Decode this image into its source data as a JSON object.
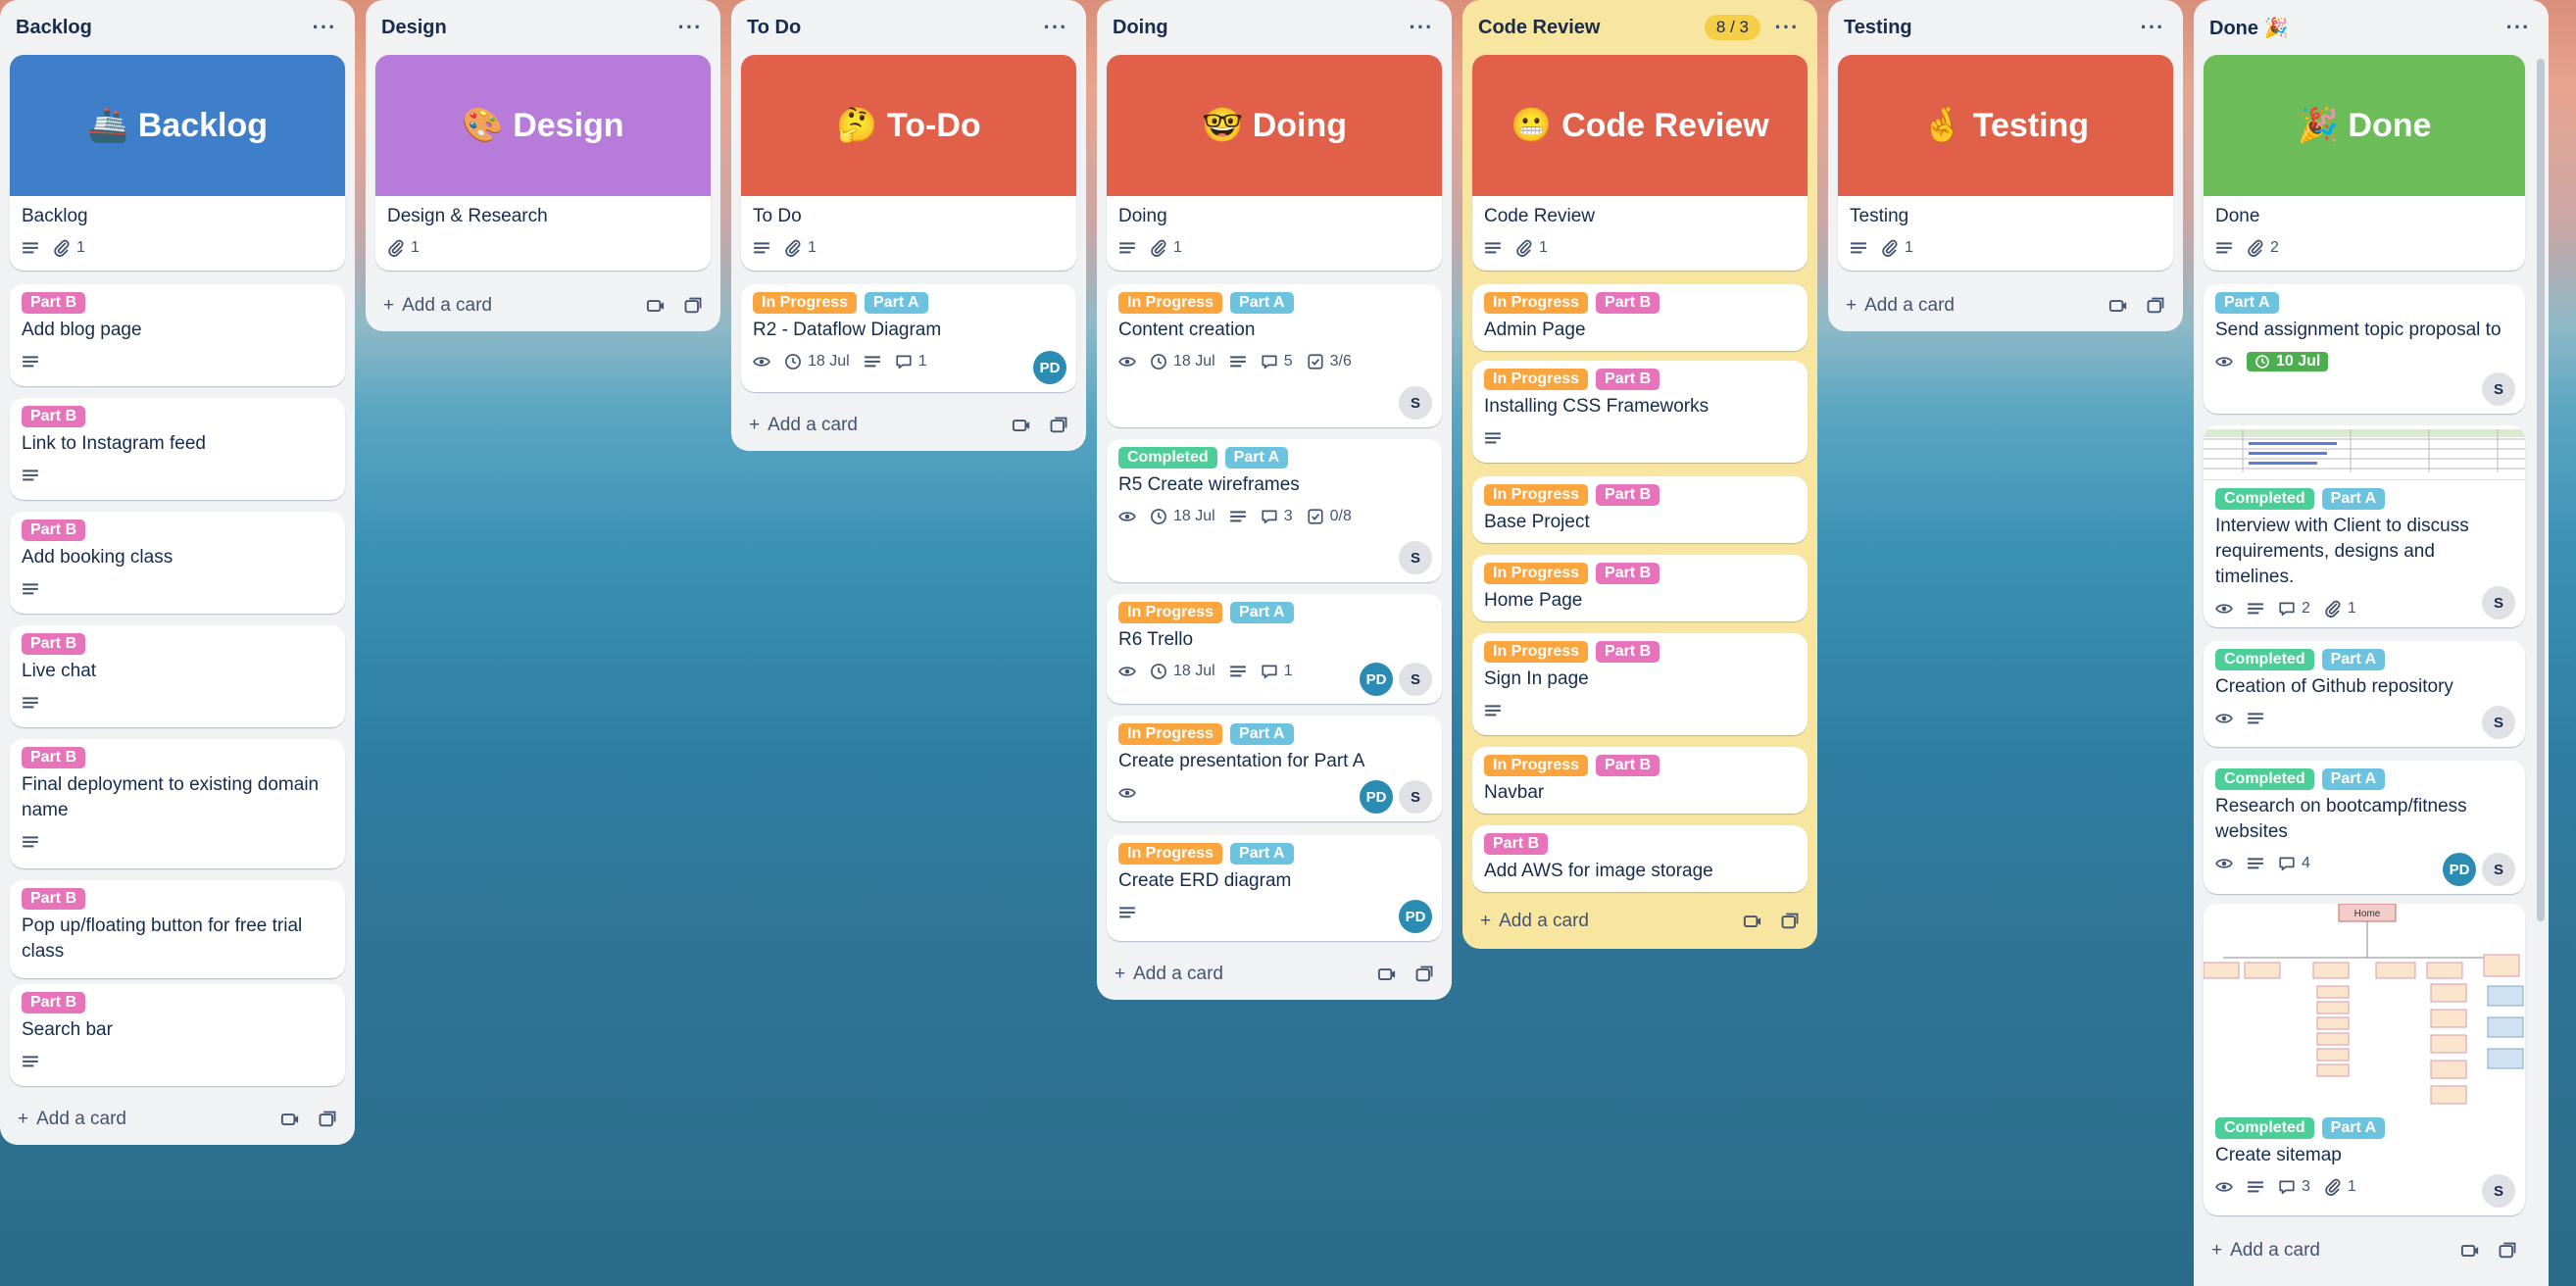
{
  "lists": [
    {
      "title": "Backlog",
      "cover_title": "🚢 Backlog",
      "cover_color": "#3f7fc9",
      "first_card_title": "Backlog",
      "first_card_attach": "1",
      "cards": [
        {
          "labels": [
            "Part B"
          ],
          "title": "Add blog page"
        },
        {
          "labels": [
            "Part B"
          ],
          "title": "Link to Instagram feed"
        },
        {
          "labels": [
            "Part B"
          ],
          "title": "Add booking class"
        },
        {
          "labels": [
            "Part B"
          ],
          "title": "Live chat"
        },
        {
          "labels": [
            "Part B"
          ],
          "title": "Final deployment to existing domain name"
        },
        {
          "labels": [
            "Part B"
          ],
          "title": "Pop up/floating button for free trial class"
        },
        {
          "labels": [
            "Part B"
          ],
          "title": "Search bar"
        }
      ],
      "add_label": "Add a card"
    },
    {
      "title": "Design",
      "cover_title": "🎨 Design",
      "cover_color": "#b77bd9",
      "first_card_title": "Design & Research",
      "first_card_attach": "1",
      "add_label": "Add a card"
    },
    {
      "title": "To Do",
      "cover_title": "🤔 To-Do",
      "cover_color": "#e0604a",
      "first_card_title": "To Do",
      "first_card_attach": "1",
      "cards": [
        {
          "labels": [
            "In Progress",
            "Part A"
          ],
          "title": "R2 - Dataflow Diagram",
          "date": "18 Jul",
          "comments": "1",
          "avatar": "PD"
        }
      ],
      "add_label": "Add a card"
    },
    {
      "title": "Doing",
      "cover_title": "🤓 Doing",
      "cover_color": "#e0604a",
      "first_card_title": "Doing",
      "first_card_attach": "1",
      "cards": [
        {
          "labels": [
            "In Progress",
            "Part A"
          ],
          "title": "Content creation",
          "date": "18 Jul",
          "comments": "5",
          "checklist": "3/6",
          "avatar": "S"
        },
        {
          "labels": [
            "Completed",
            "Part A"
          ],
          "title": "R5 Create wireframes",
          "date": "18 Jul",
          "comments": "3",
          "checklist": "0/8",
          "avatar": "S"
        },
        {
          "labels": [
            "In Progress",
            "Part A"
          ],
          "title": "R6 Trello",
          "date": "18 Jul",
          "comments": "1",
          "avatar_pd": "PD",
          "avatar_s": "S"
        },
        {
          "labels": [
            "In Progress",
            "Part A"
          ],
          "title": "Create presentation for Part A",
          "avatar_pd": "PD",
          "avatar_s": "S"
        },
        {
          "labels": [
            "In Progress",
            "Part A"
          ],
          "title": "Create ERD diagram",
          "avatar": "PD"
        }
      ],
      "add_label": "Add a card"
    },
    {
      "title": "Code Review",
      "count": "8 / 3",
      "cover_title": "😬 Code Review",
      "cover_color": "#e0604a",
      "first_card_title": "Code Review",
      "first_card_attach": "1",
      "cards": [
        {
          "labels": [
            "In Progress",
            "Part B"
          ],
          "title": "Admin Page"
        },
        {
          "labels": [
            "In Progress",
            "Part B"
          ],
          "title": "Installing CSS Frameworks"
        },
        {
          "labels": [
            "In Progress",
            "Part B"
          ],
          "title": "Base Project"
        },
        {
          "labels": [
            "In Progress",
            "Part B"
          ],
          "title": "Home Page"
        },
        {
          "labels": [
            "In Progress",
            "Part B"
          ],
          "title": "Sign In page"
        },
        {
          "labels": [
            "In Progress",
            "Part B"
          ],
          "title": "Navbar"
        },
        {
          "labels": [
            "Part B"
          ],
          "title": "Add AWS for image storage"
        }
      ],
      "add_label": "Add a card"
    },
    {
      "title": "Testing",
      "cover_title": "🤞 Testing",
      "cover_color": "#e0604a",
      "first_card_title": "Testing",
      "first_card_attach": "1",
      "add_label": "Add a card"
    },
    {
      "title": "Done 🎉",
      "cover_title": "🎉 Done",
      "cover_color": "#6cbd5a",
      "first_card_title": "Done",
      "first_card_attach": "2",
      "cards": [
        {
          "labels": [
            "Part A"
          ],
          "title": "Send assignment topic proposal to",
          "due": "10 Jul",
          "avatar": "S"
        },
        {
          "labels": [
            "Completed",
            "Part A"
          ],
          "title": "Interview with Client to discuss requirements, designs and timelines.",
          "comments": "2",
          "attach": "1",
          "avatar": "S"
        },
        {
          "labels": [
            "Completed",
            "Part A"
          ],
          "title": "Creation of Github repository",
          "avatar": "S"
        },
        {
          "labels": [
            "Completed",
            "Part A"
          ],
          "title": "Research on bootcamp/fitness websites",
          "comments": "4",
          "avatar_pd": "PD",
          "avatar_s": "S"
        },
        {
          "labels": [
            "Completed",
            "Part A"
          ],
          "title": "Create sitemap",
          "comments": "3",
          "attach": "1",
          "avatar": "S",
          "sitemap_home": "Home"
        }
      ],
      "add_label": "Add a card"
    }
  ]
}
